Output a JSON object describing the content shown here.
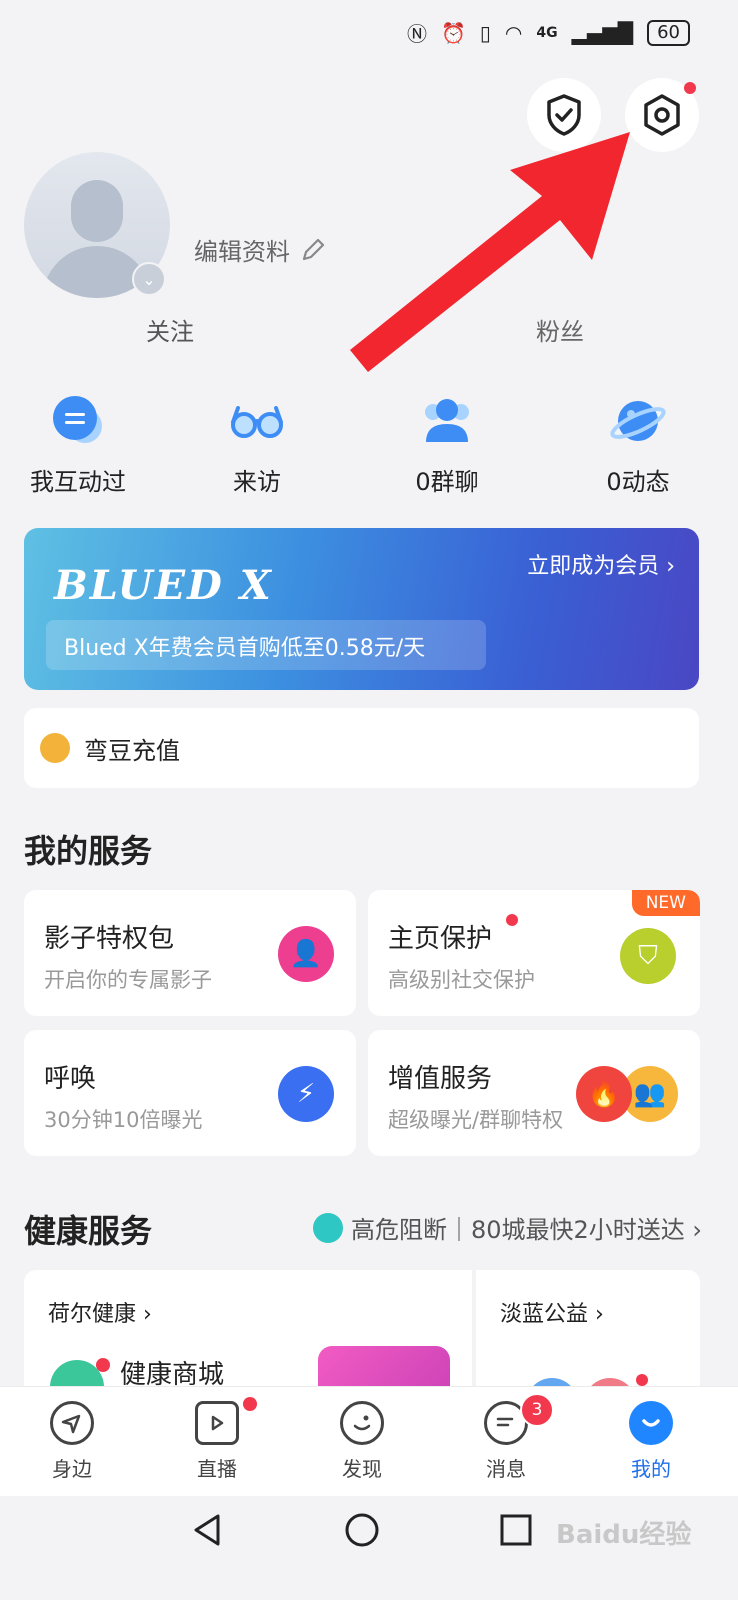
{
  "status": {
    "battery": "60",
    "net": "4G"
  },
  "profile": {
    "edit_label": "编辑资料",
    "follow_label": "关注",
    "fans_label": "粉丝"
  },
  "quick_actions": [
    {
      "label": "我互动过",
      "icon": "chat-bubble-icon"
    },
    {
      "label": "来访",
      "icon": "glasses-icon"
    },
    {
      "label": "0群聊",
      "icon": "group-icon"
    },
    {
      "label": "0动态",
      "icon": "planet-icon"
    }
  ],
  "banner": {
    "brand": "BLUED X",
    "cta": "立即成为会员 ›",
    "desc": "Blued X年费会员首购低至0.58元/天"
  },
  "recharge": {
    "label": "弯豆充值"
  },
  "services": {
    "title": "我的服务",
    "cards": [
      {
        "title": "影子特权包",
        "sub": "开启你的专属影子"
      },
      {
        "title": "主页保护",
        "sub": "高级别社交保护",
        "tag": "NEW"
      },
      {
        "title": "呼唤",
        "sub": "30分钟10倍曝光"
      },
      {
        "title": "增值服务",
        "sub": "超级曝光/群聊特权"
      }
    ]
  },
  "health": {
    "title": "健康服务",
    "link": "高危阻断｜80城最快2小时送达 ›",
    "card1_title": "荷尔健康 ›",
    "card1_item": "健康商城",
    "card2_title": "淡蓝公益 ›"
  },
  "tabs": [
    {
      "label": "身边"
    },
    {
      "label": "直播"
    },
    {
      "label": "发现"
    },
    {
      "label": "消息",
      "badge": "3"
    },
    {
      "label": "我的"
    }
  ],
  "colors": {
    "accent": "#1f86ff",
    "arrow": "#f2262f",
    "badge": "#f2384d"
  },
  "watermark": "Baidu经验"
}
